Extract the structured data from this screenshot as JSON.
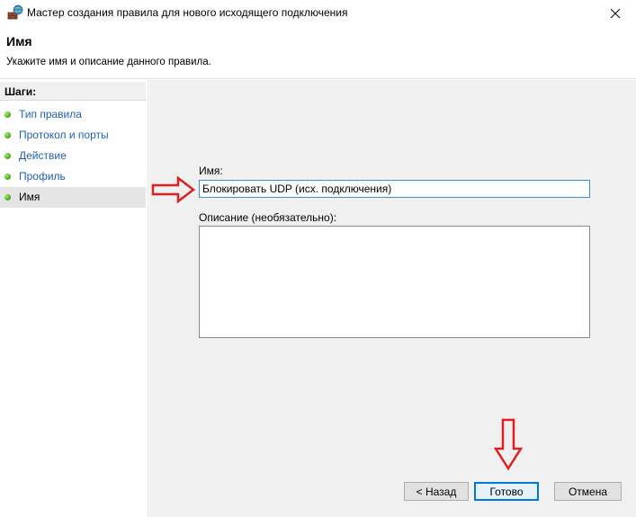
{
  "window": {
    "title": "Мастер создания правила для нового исходящего подключения",
    "icon": "firewall-wizard-icon",
    "close_icon": "close-icon"
  },
  "header": {
    "title": "Имя",
    "description": "Укажите имя и описание данного правила."
  },
  "sidebar": {
    "heading": "Шаги:",
    "steps": [
      {
        "label": "Тип правила",
        "active": false
      },
      {
        "label": "Протокол и порты",
        "active": false
      },
      {
        "label": "Действие",
        "active": false
      },
      {
        "label": "Профиль",
        "active": false
      },
      {
        "label": "Имя",
        "active": true
      }
    ]
  },
  "form": {
    "name_label": "Имя:",
    "name_value": "Блокировать UDP (исх. подключения)",
    "description_label": "Описание (необязательно):",
    "description_value": ""
  },
  "buttons": {
    "back": "< Назад",
    "finish": "Готово",
    "cancel": "Отмена"
  },
  "colors": {
    "accent": "#0078d7",
    "link": "#1f5fb8",
    "annotation_arrow": "#e02020",
    "step_dot": "#4cb51f",
    "panel_bg": "#f0f0f0"
  }
}
